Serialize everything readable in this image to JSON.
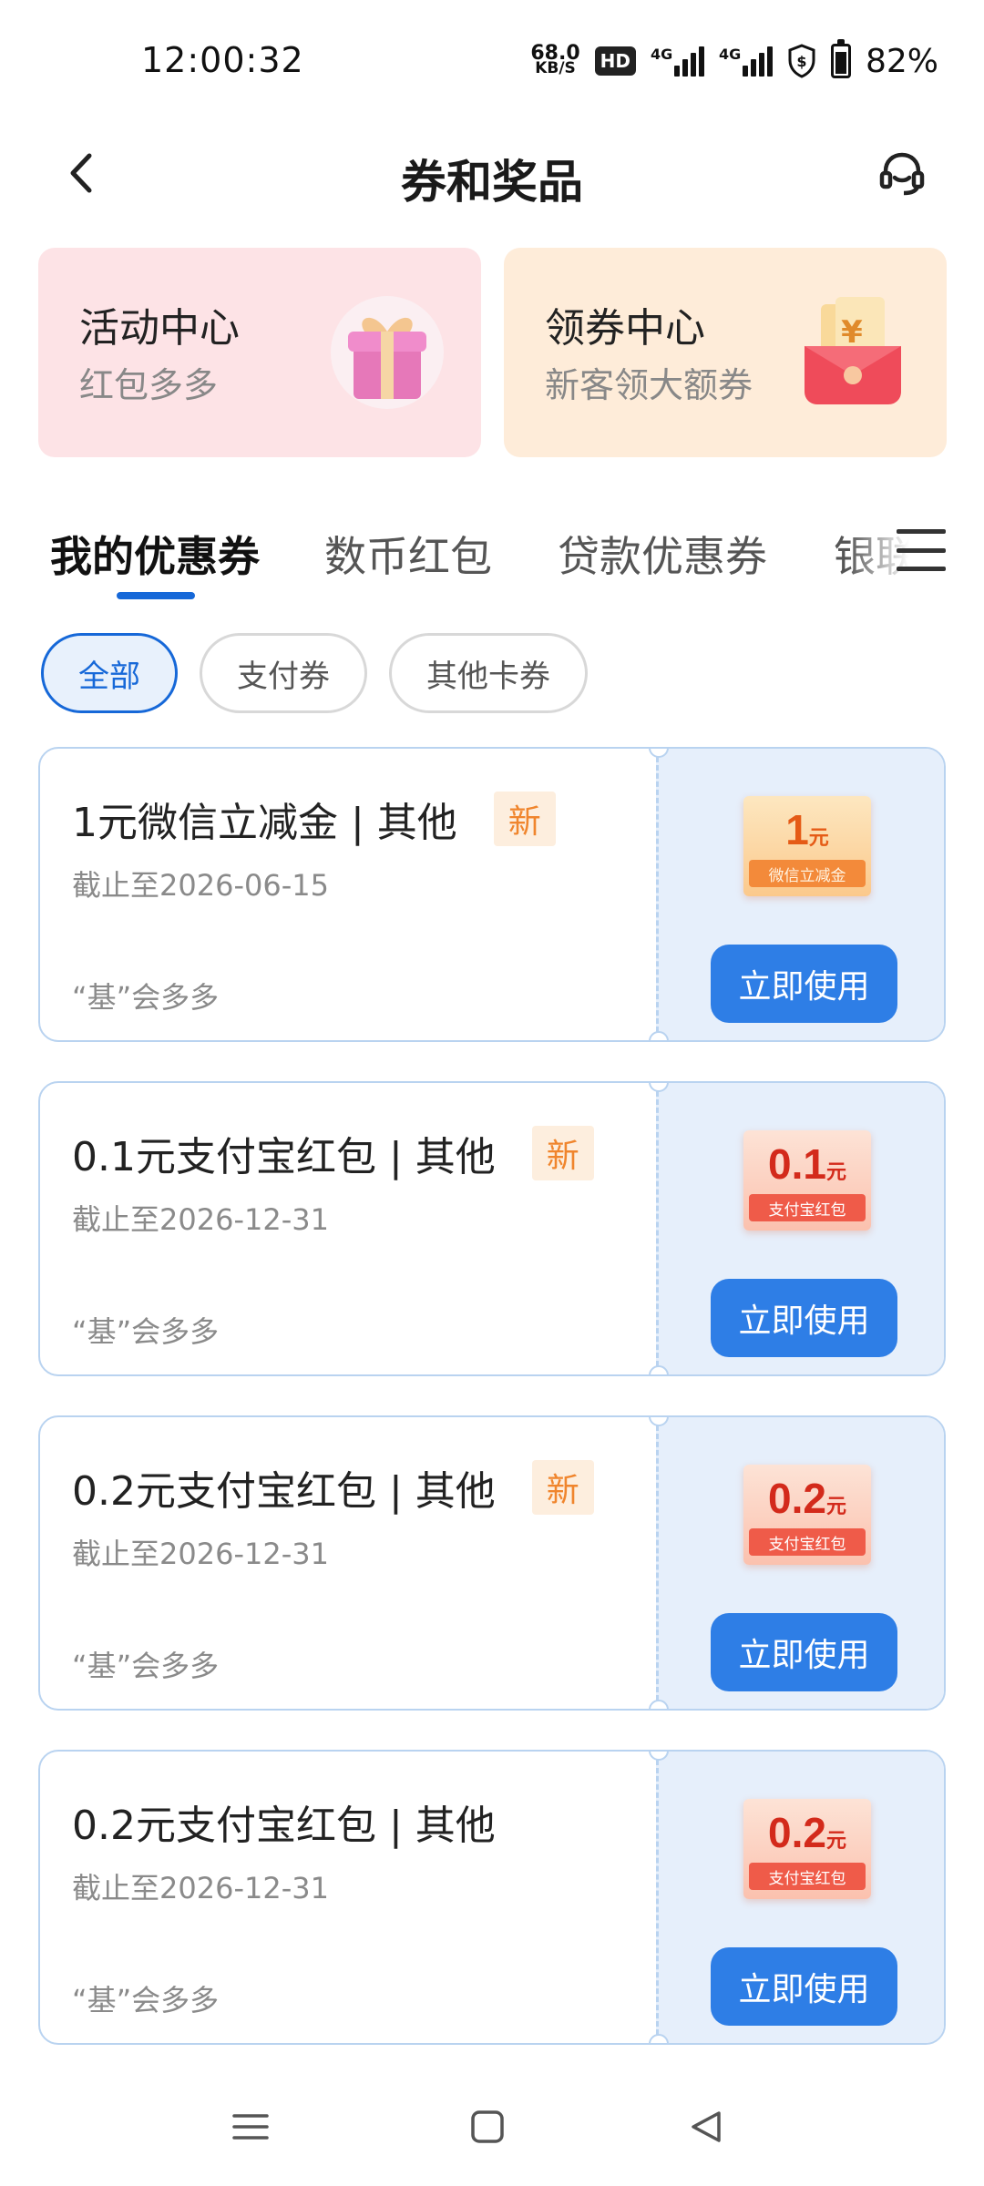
{
  "status_bar": {
    "time": "12:00:32",
    "net_speed_value": "68.0",
    "net_speed_unit": "KB/S",
    "hd_label": "HD",
    "signal1_label": "4G",
    "signal2_label": "4G",
    "battery_percent": "82%"
  },
  "header": {
    "title": "券和奖品"
  },
  "promo_cards": [
    {
      "title": "活动中心",
      "subtitle": "红包多多",
      "icon": "gift-box-icon",
      "bg": "#fde3e6"
    },
    {
      "title": "领券中心",
      "subtitle": "新客领大额券",
      "icon": "red-envelope-icon",
      "bg": "#feecd9"
    }
  ],
  "tabs": [
    {
      "label": "我的优惠券",
      "active": true
    },
    {
      "label": "数币红包",
      "active": false
    },
    {
      "label": "贷款优惠券",
      "active": false
    },
    {
      "label": "银联",
      "active": false
    }
  ],
  "filter_chips": [
    {
      "label": "全部",
      "active": true
    },
    {
      "label": "支付券",
      "active": false
    },
    {
      "label": "其他卡券",
      "active": false
    }
  ],
  "coupons": [
    {
      "title": "1元微信立减金 | 其他",
      "badge": "新",
      "expiry": "截止至2026-06-15",
      "source": "“基”会多多",
      "ticket_value": "1",
      "ticket_unit": "元",
      "ticket_label": "微信立减金",
      "button": "立即使用"
    },
    {
      "title": "0.1元支付宝红包 | 其他",
      "badge": "新",
      "expiry": "截止至2026-12-31",
      "source": "“基”会多多",
      "ticket_value": "0.1",
      "ticket_unit": "元",
      "ticket_label": "支付宝红包",
      "button": "立即使用"
    },
    {
      "title": "0.2元支付宝红包 | 其他",
      "badge": "新",
      "expiry": "截止至2026-12-31",
      "source": "“基”会多多",
      "ticket_value": "0.2",
      "ticket_unit": "元",
      "ticket_label": "支付宝红包",
      "button": "立即使用"
    },
    {
      "title": "0.2元支付宝红包 | 其他",
      "badge": "",
      "expiry": "截止至2026-12-31",
      "source": "“基”会多多",
      "ticket_value": "0.2",
      "ticket_unit": "元",
      "ticket_label": "支付宝红包",
      "button": "立即使用"
    }
  ],
  "colors": {
    "accent": "#1668d8",
    "button": "#2e7ee6",
    "badge": "#f0852d",
    "coupon_border": "#b9d3f0",
    "coupon_side": "#e6effb"
  }
}
